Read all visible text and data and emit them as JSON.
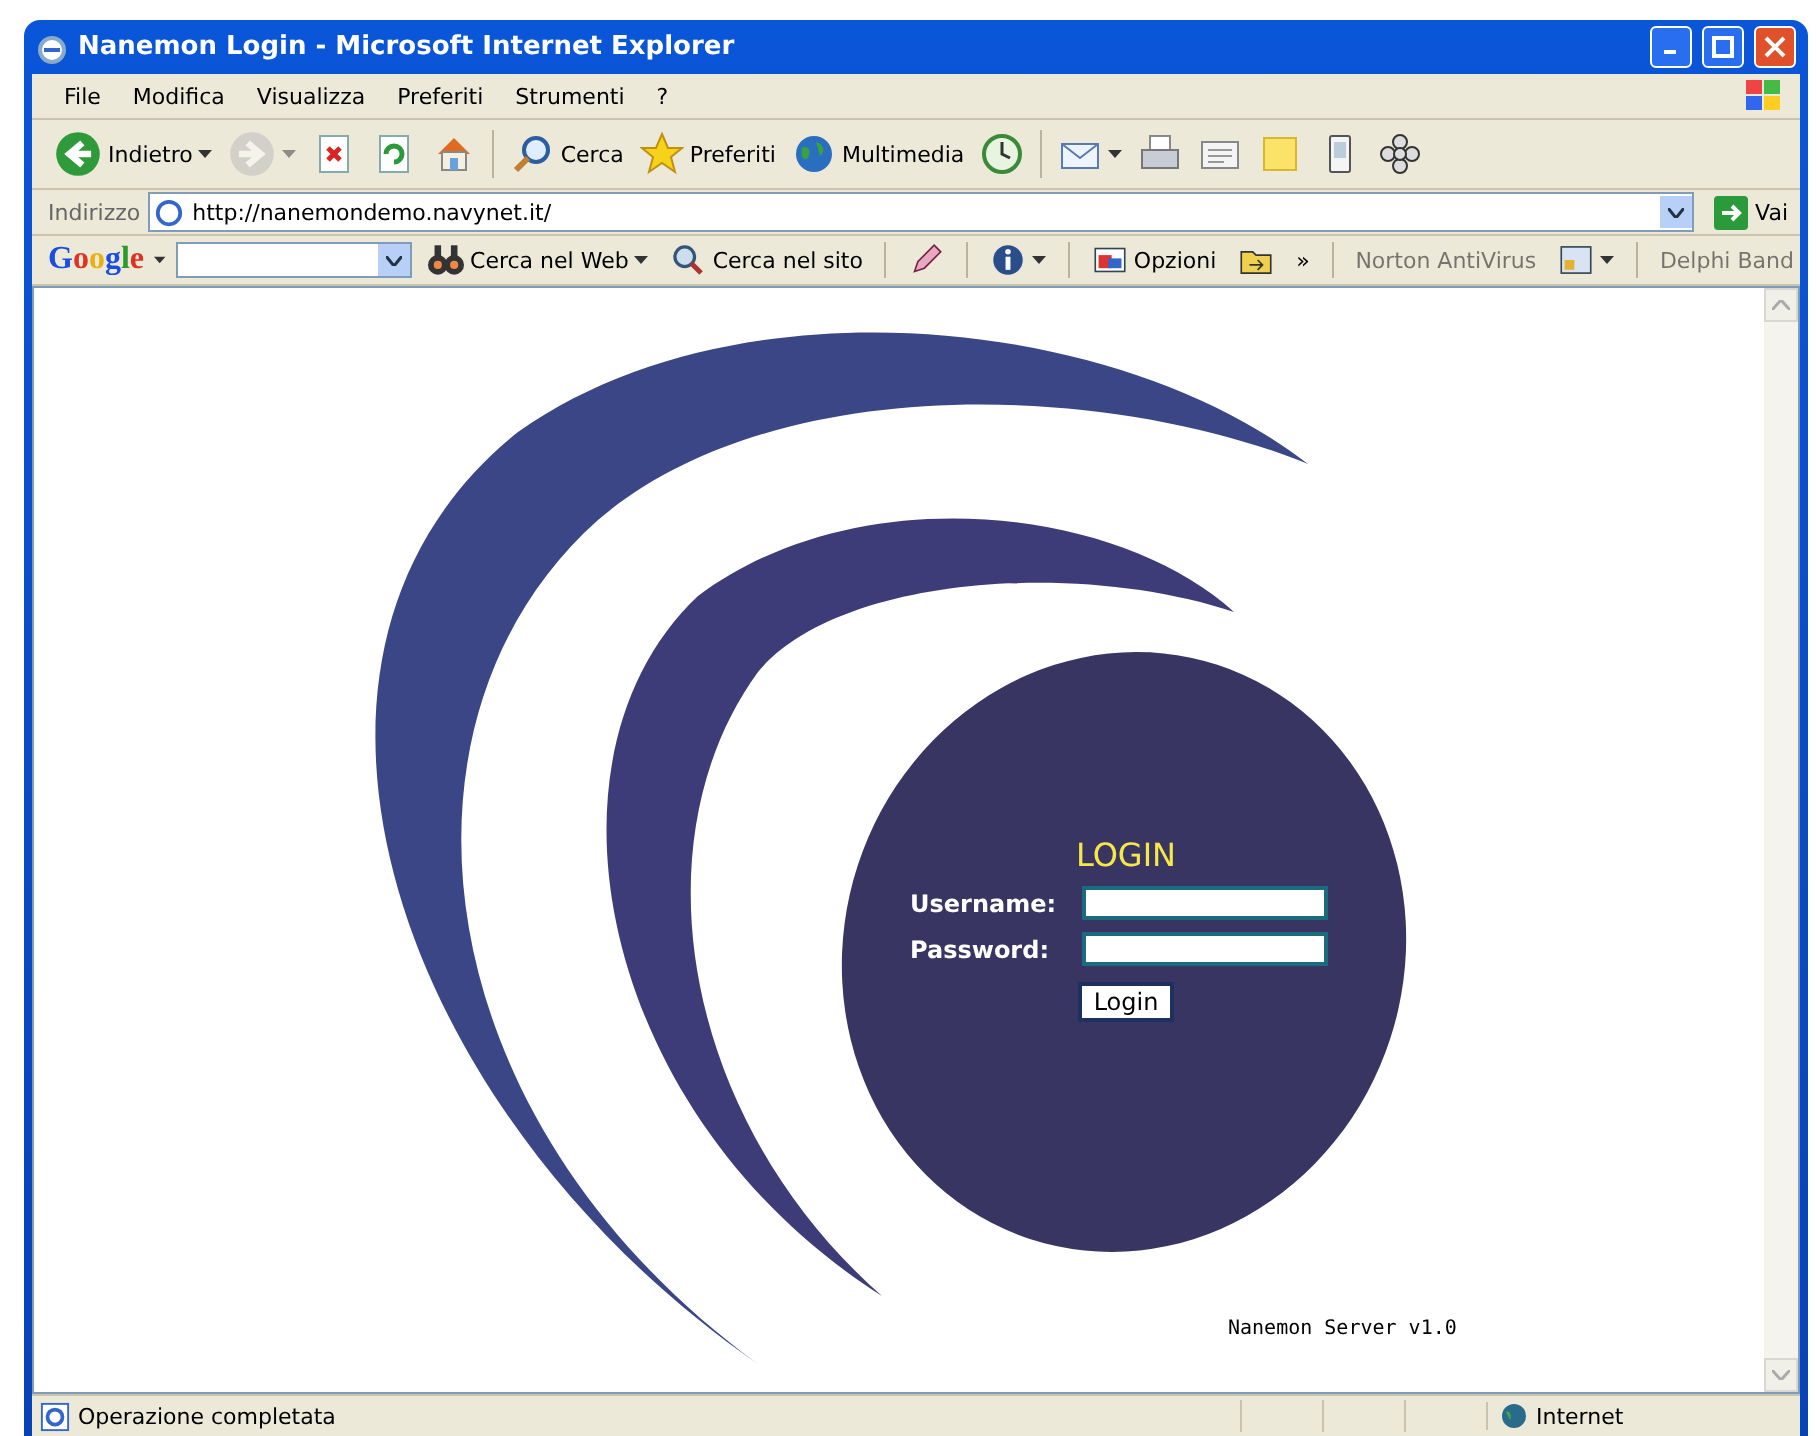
{
  "window": {
    "title": "Nanemon Login - Microsoft Internet Explorer"
  },
  "menu": [
    "File",
    "Modifica",
    "Visualizza",
    "Preferiti",
    "Strumenti",
    "?"
  ],
  "toolbar": [
    {
      "kind": "back",
      "label": "Indietro",
      "dropdown": true,
      "disabled": false
    },
    {
      "kind": "forward",
      "dropdown": true,
      "disabled": true
    },
    {
      "kind": "stop"
    },
    {
      "kind": "refresh"
    },
    {
      "kind": "home"
    },
    {
      "kind": "search",
      "label": "Cerca"
    },
    {
      "kind": "favorites",
      "label": "Preferiti"
    },
    {
      "kind": "media",
      "label": "Multimedia"
    },
    {
      "kind": "history"
    },
    {
      "kind": "mail",
      "dropdown": true
    },
    {
      "kind": "print"
    },
    {
      "kind": "edit"
    },
    {
      "kind": "note"
    },
    {
      "kind": "messenger"
    },
    {
      "kind": "flower"
    }
  ],
  "address": {
    "label": "Indirizzo",
    "url": "http://nanemondemo.navynet.it/",
    "go": "Vai"
  },
  "google_bar": {
    "logo": "Google",
    "items": [
      {
        "kind": "binoculars",
        "label": "Cerca nel Web",
        "dropdown": true,
        "disabled": false
      },
      {
        "kind": "site",
        "label": "Cerca nel sito",
        "disabled": false
      },
      {
        "kind": "pencil",
        "disabled": false
      },
      {
        "kind": "info",
        "dropdown": true,
        "disabled": false
      },
      {
        "kind": "options",
        "label": "Opzioni",
        "disabled": false
      },
      {
        "kind": "folder",
        "disabled": false
      },
      {
        "kind": "more",
        "label": "»",
        "disabled": false
      },
      {
        "kind": "norton",
        "label": "Norton AntiVirus",
        "disabled": true
      },
      {
        "kind": "shield",
        "dropdown": true,
        "disabled": false
      },
      {
        "kind": "delphi",
        "label": "Delphi Band",
        "disabled": true
      }
    ]
  },
  "page": {
    "login_title": "LOGIN",
    "username_label": "Username:",
    "password_label": "Password:",
    "login_button": "Login",
    "footer": "Nanemon Server v1.0"
  },
  "status_bar": {
    "text": "Operazione completata",
    "zone": "Internet"
  }
}
